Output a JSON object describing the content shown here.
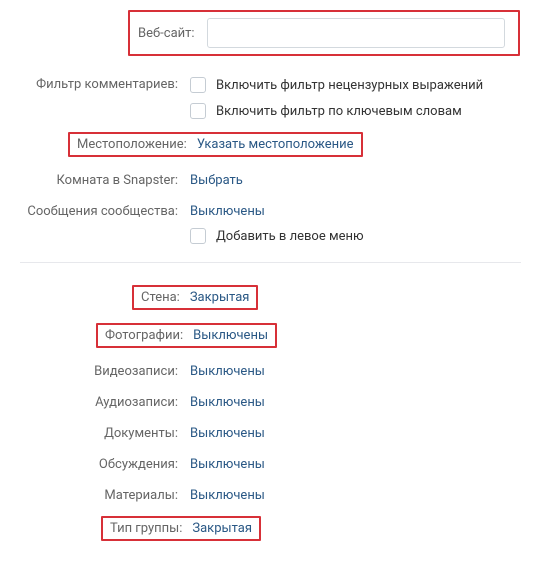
{
  "website": {
    "label": "Веб-сайт:",
    "value": ""
  },
  "comment_filter": {
    "label": "Фильтр комментариев:",
    "opt_profanity": "Включить фильтр нецензурных выражений",
    "opt_keywords": "Включить фильтр по ключевым словам"
  },
  "location": {
    "label": "Местоположение:",
    "value": "Указать местоположение"
  },
  "snapster": {
    "label": "Комната в Snapster:",
    "value": "Выбрать"
  },
  "messages": {
    "label": "Сообщения сообщества:",
    "value": "Выключены",
    "add_to_left_menu": "Добавить в левое меню"
  },
  "sections": {
    "wall": {
      "label": "Стена:",
      "value": "Закрытая"
    },
    "photos": {
      "label": "Фотографии:",
      "value": "Выключены"
    },
    "videos": {
      "label": "Видеозаписи:",
      "value": "Выключены"
    },
    "audios": {
      "label": "Аудиозаписи:",
      "value": "Выключены"
    },
    "docs": {
      "label": "Документы:",
      "value": "Выключены"
    },
    "topics": {
      "label": "Обсуждения:",
      "value": "Выключены"
    },
    "materials": {
      "label": "Материалы:",
      "value": "Выключены"
    },
    "group_type": {
      "label": "Тип группы:",
      "value": "Закрытая"
    }
  }
}
